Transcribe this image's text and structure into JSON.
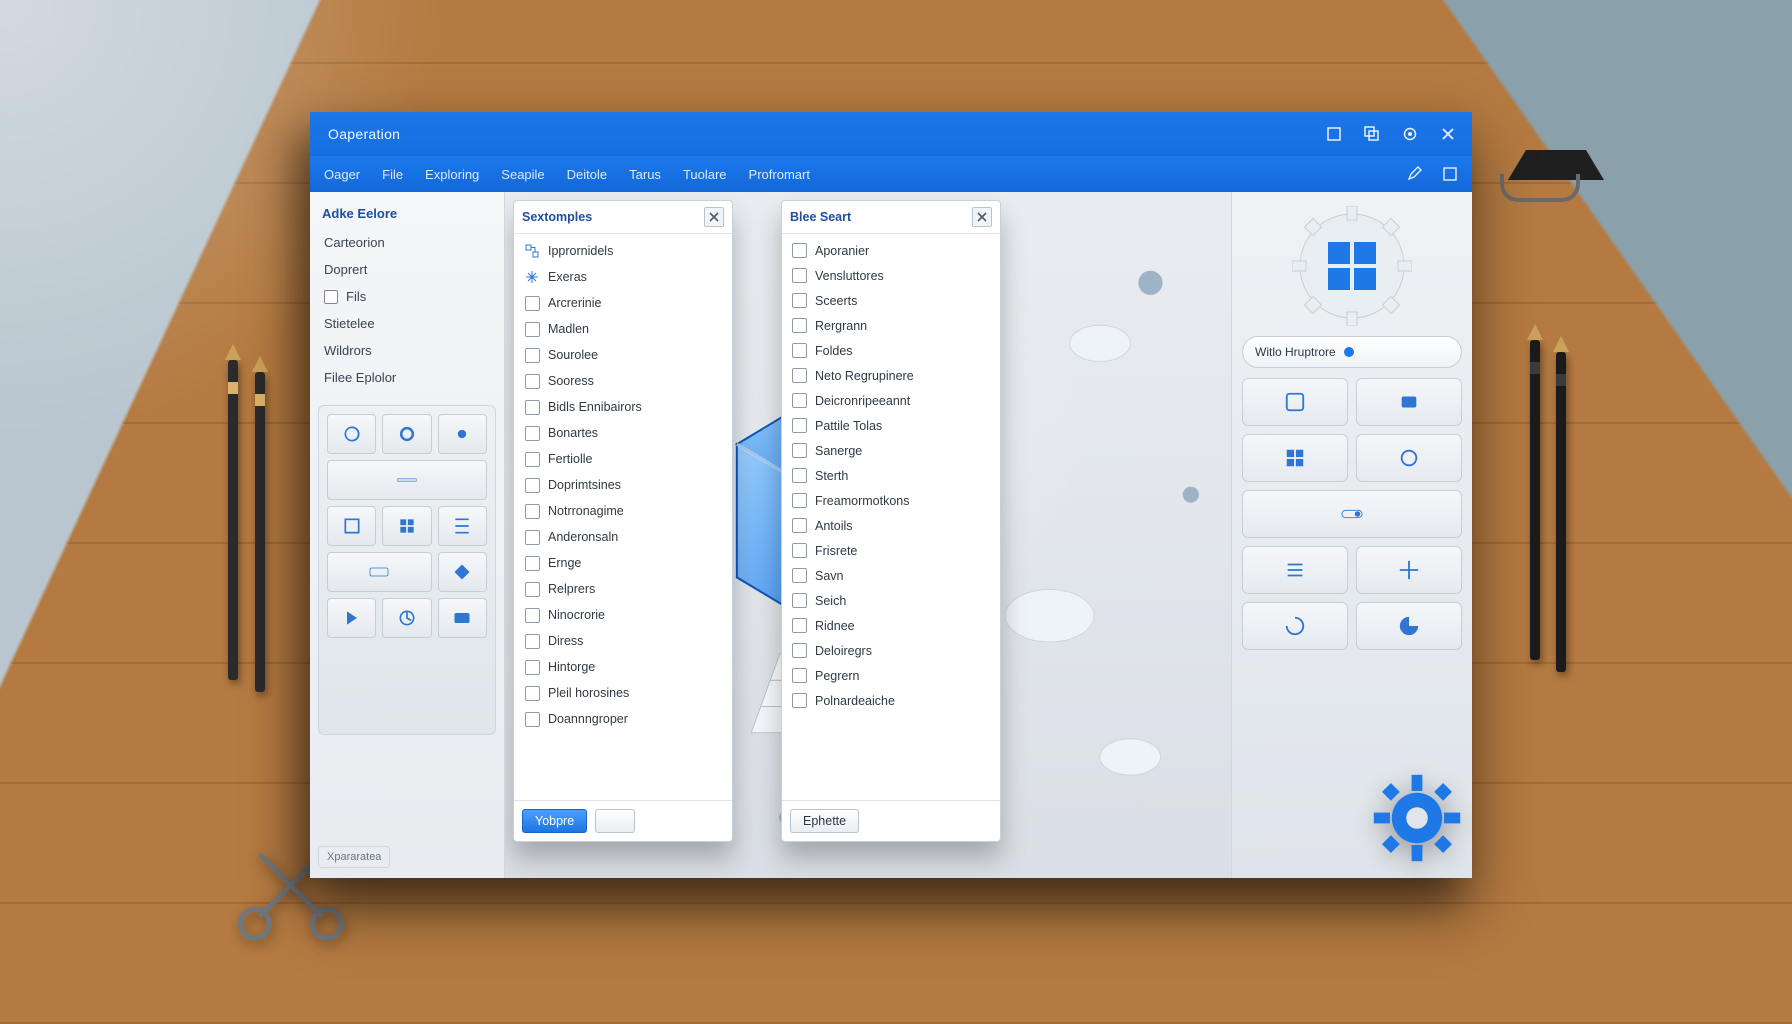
{
  "window": {
    "title": "Oaperation",
    "buttons": {
      "min": "minimize",
      "max": "maximize",
      "settings": "settings",
      "close": "close"
    }
  },
  "menu": {
    "items": [
      "Oager",
      "File",
      "Exploring",
      "Seapile",
      "Deitole",
      "Tarus",
      "Tuolare",
      "Profromart"
    ]
  },
  "sidebar": {
    "title": "Adke Eelore",
    "items": [
      {
        "label": "Carteorion"
      },
      {
        "label": "Doprert"
      },
      {
        "label": "Fils",
        "hasBox": true
      },
      {
        "label": "Stietelee"
      },
      {
        "label": "Wildrors"
      },
      {
        "label": "Filee Eplolor"
      }
    ],
    "footer": "Xpararatea"
  },
  "panel_left": {
    "title": "Sextomples",
    "items": [
      {
        "label": "Ipprornidels",
        "icon": "tree"
      },
      {
        "label": "Exeras",
        "icon": "spark"
      },
      {
        "label": "Arcrerinie",
        "icon": "check"
      },
      {
        "label": "Madlen",
        "icon": "check"
      },
      {
        "label": "Sourolee",
        "icon": "check"
      },
      {
        "label": "Sooress",
        "icon": "check"
      },
      {
        "label": "Bidls Ennibairors",
        "icon": "check"
      },
      {
        "label": "Bonartes",
        "icon": "check"
      },
      {
        "label": "Fertiolle",
        "icon": "check"
      },
      {
        "label": "Doprimtsines",
        "icon": "check"
      },
      {
        "label": "Notrronagime",
        "icon": "check"
      },
      {
        "label": "Anderonsaln",
        "icon": "check"
      },
      {
        "label": "Ernge",
        "icon": "check"
      },
      {
        "label": "Relprers",
        "icon": "check"
      },
      {
        "label": "Ninocrorie",
        "icon": "check"
      },
      {
        "label": "Diress",
        "icon": "check"
      },
      {
        "label": "Hintorge",
        "icon": "check"
      },
      {
        "label": "Pleil horosines",
        "icon": "check"
      },
      {
        "label": "Doannngroper",
        "icon": "check"
      }
    ],
    "primary_button": "Yobpre"
  },
  "panel_right": {
    "title": "Blee Seart",
    "items": [
      {
        "label": "Aporanier"
      },
      {
        "label": "Vensluttores"
      },
      {
        "label": "Sceerts"
      },
      {
        "label": "Rergrann"
      },
      {
        "label": "Foldes"
      },
      {
        "label": "Neto Regrupinere"
      },
      {
        "label": "Deicronripeeannt"
      },
      {
        "label": "Pattile Tolas"
      },
      {
        "label": "Sanerge"
      },
      {
        "label": "Sterth"
      },
      {
        "label": "Freamormotkons"
      },
      {
        "label": "Antoils"
      },
      {
        "label": "Frisrete"
      },
      {
        "label": "Savn"
      },
      {
        "label": "Seich"
      },
      {
        "label": "Ridnee"
      },
      {
        "label": "Deloiregrs"
      },
      {
        "label": "Pegrern"
      },
      {
        "label": "Polnardeaiche"
      }
    ],
    "primary_button": "Ephette"
  },
  "right_column": {
    "pill": "Witlo Hruptrore"
  }
}
